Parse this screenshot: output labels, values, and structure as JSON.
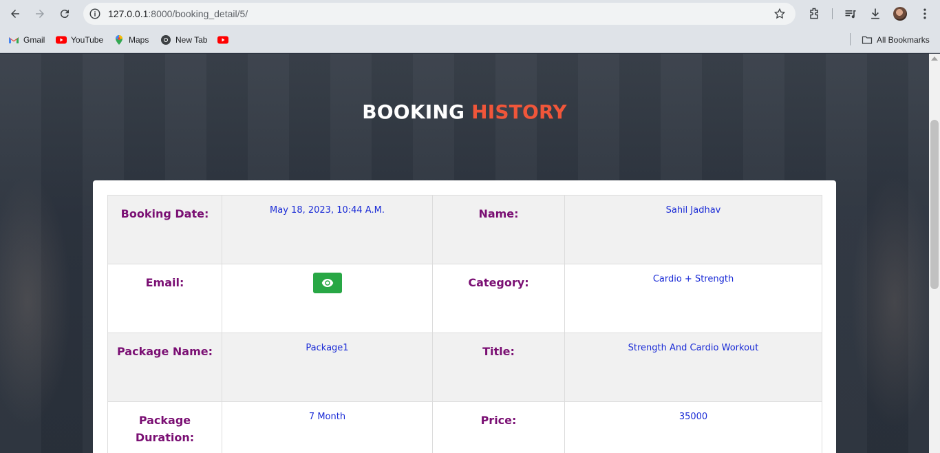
{
  "browser": {
    "url_host": "127.0.0.1",
    "url_path": ":8000/booking_detail/5/",
    "bookmarks": [
      {
        "label": "Gmail",
        "icon": "gmail-icon"
      },
      {
        "label": "YouTube",
        "icon": "youtube-icon"
      },
      {
        "label": "Maps",
        "icon": "maps-icon"
      },
      {
        "label": "New Tab",
        "icon": "chrome-icon"
      },
      {
        "label": "",
        "icon": "youtube-icon"
      }
    ],
    "all_bookmarks_label": "All Bookmarks"
  },
  "page": {
    "heading_part1": "BOOKING",
    "heading_part2": "HISTORY",
    "heading_colors": {
      "part1": "#ffffff",
      "part2": "#f0563a"
    },
    "label_color": "#7a0f73",
    "value_color": "#1a2bd6",
    "view_button_color": "#28a745"
  },
  "details": {
    "booking_date_label": "Booking Date:",
    "booking_date_value": "May 18, 2023, 10:44 A.M.",
    "name_label": "Name:",
    "name_value": "Sahil Jadhav",
    "email_label": "Email:",
    "email_button_icon": "eye-icon",
    "category_label": "Category:",
    "category_value": "Cardio + Strength",
    "package_name_label": "Package Name:",
    "package_name_value": "Package1",
    "title_label": "Title:",
    "title_value": "Strength And Cardio Workout",
    "package_duration_label_line1": "Package",
    "package_duration_label_line2": "Duration:",
    "package_duration_value": "7 Month",
    "price_label": "Price:",
    "price_value": "35000"
  }
}
